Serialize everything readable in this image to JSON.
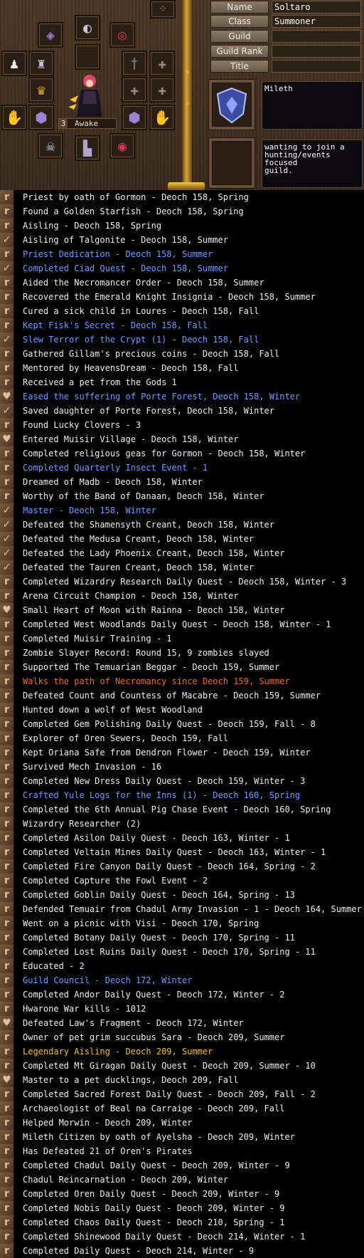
{
  "profile": {
    "labels": [
      "Name",
      "Class",
      "Guild",
      "Guild Rank",
      "Title"
    ],
    "values": [
      "Soltaro",
      "Summoner",
      "",
      "",
      ""
    ],
    "nation": "Mileth",
    "message": "wanting to join a\nhunting/events focused\nguild.",
    "state_number": "3",
    "state": "Awake"
  },
  "equipment_icons": [
    "amethyst-helm-icon",
    "ring-icon",
    "ruby-necklace-icon",
    "menu-icon",
    "empty-slot-icon",
    "figure-icon",
    "armor-icon",
    "gold-crown-icon",
    "dagger-icon",
    "shadow-icon",
    "shadow-icon",
    "gauntlet-icon",
    "gauntlet-icon",
    "shadow-icon",
    "shadow-icon",
    "amethyst-shield-icon",
    "amethyst-shield-icon",
    "amethyst-gauntlet-icon",
    "gauntlet-icon",
    "skull-icon",
    "boots-icon",
    "ruby-belt-icon"
  ],
  "colors": {
    "default": "#efefef",
    "blue": "#6f9bff",
    "orange": "#e56d1e",
    "gold": "#f2c400"
  },
  "legend": [
    {
      "mark": "r",
      "text": "Priest by oath of Gormon - Deoch 158, Spring",
      "color": "default"
    },
    {
      "mark": "r",
      "text": "Found a Golden Starfish - Deoch 158, Spring",
      "color": "default"
    },
    {
      "mark": "r",
      "text": "Aisling - Deoch 158, Spring",
      "color": "default"
    },
    {
      "mark": "check",
      "text": "Aisling of Talgonite - Deoch 158, Summer",
      "color": "default"
    },
    {
      "mark": "r",
      "text": "Priest Dedication - Deoch 158, Summer",
      "color": "blue"
    },
    {
      "mark": "check",
      "text": "Completed Ciad Quest - Deoch 158, Summer",
      "color": "blue"
    },
    {
      "mark": "r",
      "text": "Aided the Necromancer Order - Deoch 158, Summer",
      "color": "default"
    },
    {
      "mark": "r",
      "text": "Recovered the Emerald Knight Insignia - Deoch 158, Summer",
      "color": "default"
    },
    {
      "mark": "r",
      "text": "Cured a sick child in Loures - Deoch 158, Fall",
      "color": "default"
    },
    {
      "mark": "r",
      "text": "Kept Fisk's Secret - Deoch 158, Fall",
      "color": "blue"
    },
    {
      "mark": "check",
      "text": "Slew Terror of the Crypt (1) - Deoch 158, Fall",
      "color": "blue"
    },
    {
      "mark": "r",
      "text": "Gathered Gillam's precious coins - Deoch 158, Fall",
      "color": "default"
    },
    {
      "mark": "r",
      "text": "Mentored by HeavensDream - Deoch 158, Fall",
      "color": "default"
    },
    {
      "mark": "r",
      "text": "Received a pet from the Gods 1",
      "color": "default"
    },
    {
      "mark": "heart",
      "text": "Eased the suffering of Porte Forest, Deoch 158, Winter",
      "color": "blue"
    },
    {
      "mark": "check",
      "text": "Saved daughter of Porte Forest, Deoch 158, Winter",
      "color": "default"
    },
    {
      "mark": "r",
      "text": "Found Lucky Clovers - 3",
      "color": "default"
    },
    {
      "mark": "heart",
      "text": "Entered Muisir Village - Deoch 158, Winter",
      "color": "default"
    },
    {
      "mark": "r",
      "text": "Completed religious geas for Gormon - Deoch 158, Winter",
      "color": "default"
    },
    {
      "mark": "r",
      "text": "Completed Quarterly Insect Event - 1",
      "color": "blue"
    },
    {
      "mark": "r",
      "text": "Dreamed of Madb - Deoch 158, Winter",
      "color": "default"
    },
    {
      "mark": "r",
      "text": "Worthy of the Band of Danaan, Deoch 158, Winter",
      "color": "default"
    },
    {
      "mark": "check",
      "text": "Master - Deoch 158, Winter",
      "color": "blue"
    },
    {
      "mark": "check",
      "text": "Defeated the Shamensyth Creant, Deoch 158, Winter",
      "color": "default"
    },
    {
      "mark": "check",
      "text": "Defeated the Medusa Creant, Deoch 158, Winter",
      "color": "default"
    },
    {
      "mark": "check",
      "text": "Defeated the Lady Phoenix Creant, Deoch 158, Winter",
      "color": "default"
    },
    {
      "mark": "check",
      "text": "Defeated the Tauren Creant, Deoch 158, Winter",
      "color": "default"
    },
    {
      "mark": "r",
      "text": "Completed Wizardry Research Daily Quest - Deoch 158, Winter - 3",
      "color": "default"
    },
    {
      "mark": "r",
      "text": "Arena Circuit Champion - Deoch 158, Winter",
      "color": "default"
    },
    {
      "mark": "heart",
      "text": "Small Heart of Moon with Rainna - Deoch 158, Winter",
      "color": "default"
    },
    {
      "mark": "r",
      "text": "Completed West Woodlands Daily Quest - Deoch 158, Winter - 1",
      "color": "default"
    },
    {
      "mark": "r",
      "text": "Completed Muisir Training - 1",
      "color": "default"
    },
    {
      "mark": "r",
      "text": "Zombie Slayer Record: Round 15, 9 zombies slayed",
      "color": "default"
    },
    {
      "mark": "r",
      "text": "Supported The Temuarian Beggar - Deoch 159, Summer",
      "color": "default"
    },
    {
      "mark": "r",
      "text": "Walks the path of Necromancy since Deoch 159, Summer",
      "color": "orange"
    },
    {
      "mark": "r",
      "text": "Defeated Count and Countess of Macabre - Deoch 159, Summer",
      "color": "default"
    },
    {
      "mark": "r",
      "text": "Hunted down a wolf of West Woodland",
      "color": "default"
    },
    {
      "mark": "r",
      "text": "Completed Gem Polishing Daily Quest - Deoch 159, Fall - 8",
      "color": "default"
    },
    {
      "mark": "r",
      "text": "Explorer of Oren Sewers, Deoch 159, Fall",
      "color": "default"
    },
    {
      "mark": "r",
      "text": "Kept Oriana Safe from Dendron Flower - Deoch 159, Winter",
      "color": "default"
    },
    {
      "mark": "r",
      "text": "Survived Mech Invasion - 16",
      "color": "default"
    },
    {
      "mark": "r",
      "text": "Completed New Dress Daily Quest - Deoch 159, Winter - 3",
      "color": "default"
    },
    {
      "mark": "r",
      "text": "Crafted Yule Logs for the Inns (1) - Deoch 160, Spring",
      "color": "blue"
    },
    {
      "mark": "r",
      "text": "Completed the 6th Annual Pig Chase Event - Deoch 160, Spring",
      "color": "default"
    },
    {
      "mark": "r",
      "text": "Wizardry Researcher (2)",
      "color": "default"
    },
    {
      "mark": "r",
      "text": "Completed Asilon Daily Quest - Deoch 163, Winter - 1",
      "color": "default"
    },
    {
      "mark": "r",
      "text": "Completed Veltain Mines Daily Quest - Deoch 163, Winter - 1",
      "color": "default"
    },
    {
      "mark": "r",
      "text": "Completed Fire Canyon Daily Quest - Deoch 164, Spring - 2",
      "color": "default"
    },
    {
      "mark": "r",
      "text": "Completed Capture the Fowl Event - 2",
      "color": "default"
    },
    {
      "mark": "r",
      "text": "Completed Goblin Daily Quest - Deoch 164, Spring - 13",
      "color": "default"
    },
    {
      "mark": "r",
      "text": "Defended Temuair from Chadul Army Invasion - 1 - Deoch 164, Summer",
      "color": "default"
    },
    {
      "mark": "r",
      "text": "Went on a picnic with Visi - Deoch 170, Spring",
      "color": "default"
    },
    {
      "mark": "r",
      "text": "Completed Botany Daily Quest - Deoch 170, Spring - 11",
      "color": "default"
    },
    {
      "mark": "r",
      "text": "Completed Lost Ruins Daily Quest - Deoch 170, Spring - 11",
      "color": "default"
    },
    {
      "mark": "r",
      "text": "Educated - 2",
      "color": "default"
    },
    {
      "mark": "r",
      "text": "Guild Council - Deoch 172, Winter",
      "color": "blue"
    },
    {
      "mark": "r",
      "text": "Completed Andor Daily Quest - Deoch 172, Winter - 2",
      "color": "default"
    },
    {
      "mark": "r",
      "text": "Hwarone War kills - 1012",
      "color": "default"
    },
    {
      "mark": "heart",
      "text": "Defeated Law's Fragment - Deoch 172, Winter",
      "color": "default"
    },
    {
      "mark": "r",
      "text": "Owner of pet grim succubus Sara - Deoch 209, Summer",
      "color": "default"
    },
    {
      "mark": "r",
      "text": "Legendary Aisling - Deoch 209, Summer",
      "color": "gold"
    },
    {
      "mark": "r",
      "text": "Completed Mt Giragan Daily Quest - Deoch 209, Summer - 10",
      "color": "default"
    },
    {
      "mark": "heart",
      "text": "Master to a pet ducklings, Deoch 209, Fall",
      "color": "default"
    },
    {
      "mark": "r",
      "text": "Completed Sacred Forest Daily Quest - Deoch 209, Fall - 2",
      "color": "default"
    },
    {
      "mark": "r",
      "text": "Archaeologist of Beal na Carraige - Deoch 209, Fall",
      "color": "default"
    },
    {
      "mark": "r",
      "text": "Helped Morwin - Deoch 209, Winter",
      "color": "default"
    },
    {
      "mark": "r",
      "text": "Mileth Citizen by oath of Ayelsha - Deoch 209, Winter",
      "color": "default"
    },
    {
      "mark": "r",
      "text": "Has Defeated 21 of Oren's Pirates",
      "color": "default"
    },
    {
      "mark": "r",
      "text": "Completed Chadul Daily Quest - Deoch 209, Winter - 9",
      "color": "default"
    },
    {
      "mark": "r",
      "text": "Chadul Reincarnation - Deoch 209, Winter",
      "color": "default"
    },
    {
      "mark": "r",
      "text": "Completed Oren Daily Quest - Deoch 209, Winter - 9",
      "color": "default"
    },
    {
      "mark": "r",
      "text": "Completed Nobis Daily Quest - Deoch 209, Winter - 9",
      "color": "default"
    },
    {
      "mark": "r",
      "text": "Completed Chaos Daily Quest - Deoch 210, Spring - 1",
      "color": "default"
    },
    {
      "mark": "r",
      "text": "Completed Shinewood Daily Quest - Deoch 214, Winter - 1",
      "color": "default"
    },
    {
      "mark": "r",
      "text": "Completed Daily Quest - Deoch 214, Winter - 9",
      "color": "default"
    }
  ]
}
